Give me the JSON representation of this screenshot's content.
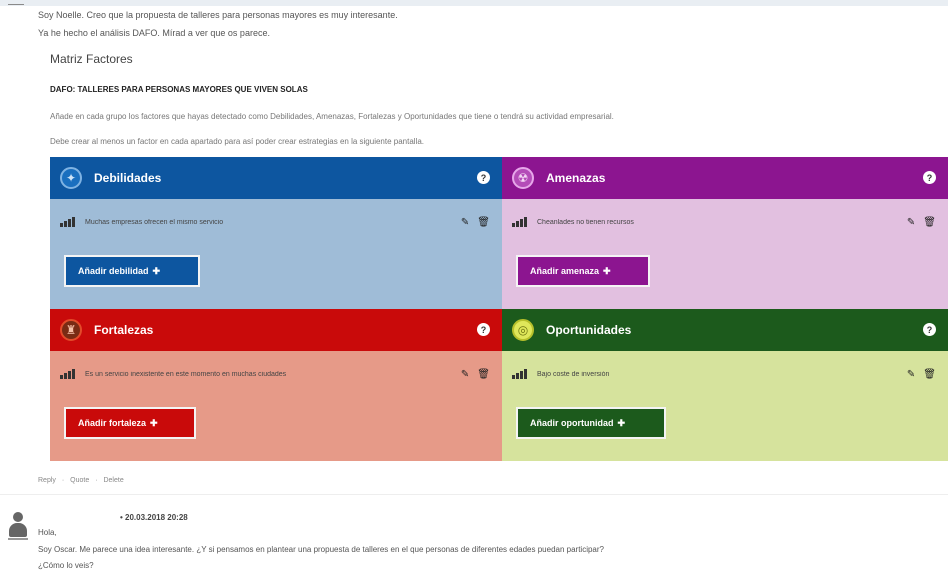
{
  "post": {
    "line1": "Soy Noelle. Creo que la propuesta de talleres para personas mayores es muy interesante.",
    "line2": "Ya he hecho el análisis DAFO. Mírad a ver que os parece."
  },
  "matrix": {
    "title": "Matriz Factores",
    "subtitle": "DAFO: TALLERES PARA PERSONAS MAYORES QUE VIVEN SOLAS",
    "instruction1": "Añade en cada grupo los factores que hayas detectado como Debilidades, Amenazas, Fortalezas y Oportunidades que tiene o tendrá su actividad empresarial.",
    "instruction2": "Debe crear al menos un factor en cada apartado para así poder crear estrategias en la siguiente pantalla.",
    "quadrants": [
      {
        "id": "deb",
        "title": "Debilidades",
        "icon": "shield-icon",
        "help": "?",
        "item": "Muchas empresas ofrecen el mismo servicio",
        "button": "Añadir debilidad",
        "color": "#0d56a0",
        "bg": "#9fbcd7"
      },
      {
        "id": "ame",
        "title": "Amenazas",
        "icon": "radiation-icon",
        "help": "?",
        "item": "Cheanlades no tienen recursos",
        "button": "Añadir amenaza",
        "color": "#8c1590",
        "bg": "#e2c0e0"
      },
      {
        "id": "for",
        "title": "Fortalezas",
        "icon": "fortress-icon",
        "help": "?",
        "item": "Es un servicio inexistente en este momento en muchas ciudades",
        "button": "Añadir fortaleza",
        "color": "#c90a0a",
        "bg": "#e69a88"
      },
      {
        "id": "opo",
        "title": "Oportunidades",
        "icon": "target-icon",
        "help": "?",
        "item": "Bajo coste de inversión",
        "button": "Añadir oportunidad",
        "color": "#1c5a1c",
        "bg": "#d6e39d"
      }
    ]
  },
  "links": {
    "reply": "Reply",
    "quote": "Quote",
    "delete": "Delete",
    "sep": "·"
  },
  "comment": {
    "date": "• 20.03.2018 20:28",
    "greet": "Hola,",
    "body": "Soy Oscar. Me parece una idea interesante. ¿Y si pensamos en plantear una propuesta de talleres en el que personas de diferentes edades puedan participar?",
    "question": "¿Cómo lo veis?"
  }
}
